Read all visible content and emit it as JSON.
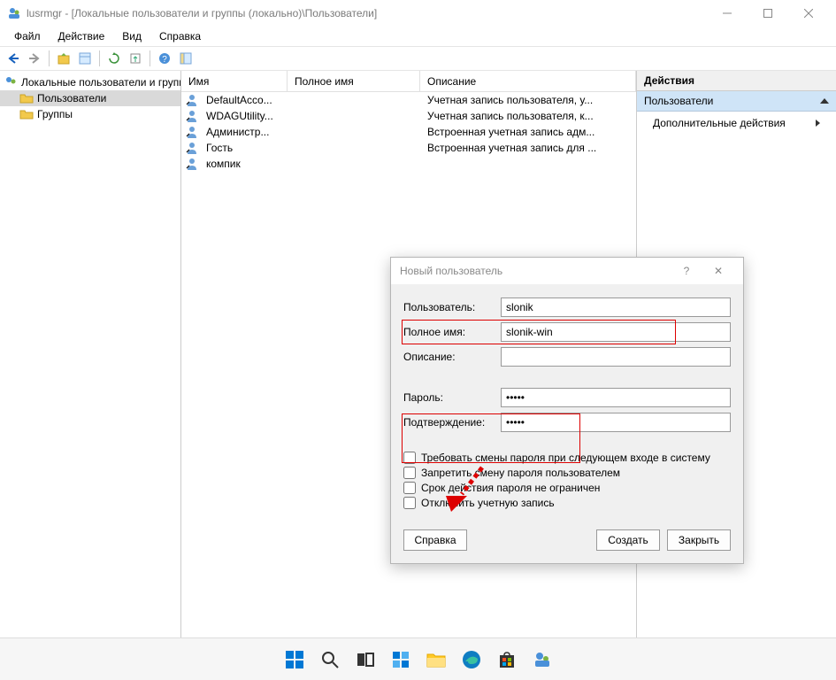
{
  "titlebar": {
    "text": "lusrmgr - [Локальные пользователи и группы (локально)\\Пользователи]"
  },
  "menubar": [
    "Файл",
    "Действие",
    "Вид",
    "Справка"
  ],
  "tree": {
    "root": "Локальные пользователи и группы",
    "users": "Пользователи",
    "groups": "Группы"
  },
  "list": {
    "headers": {
      "name": "Имя",
      "full": "Полное имя",
      "desc": "Описание"
    },
    "rows": [
      {
        "name": "DefaultAcco...",
        "full": "",
        "desc": "Учетная запись пользователя, у..."
      },
      {
        "name": "WDAGUtility...",
        "full": "",
        "desc": "Учетная запись пользователя, к..."
      },
      {
        "name": "Администр...",
        "full": "",
        "desc": "Встроенная учетная запись адм..."
      },
      {
        "name": "Гость",
        "full": "",
        "desc": "Встроенная учетная запись для ..."
      },
      {
        "name": "компик",
        "full": "",
        "desc": ""
      }
    ]
  },
  "actions": {
    "title": "Действия",
    "section": "Пользователи",
    "item": "Дополнительные действия"
  },
  "dialog": {
    "title": "Новый пользователь",
    "labels": {
      "user": "Пользователь:",
      "full": "Полное имя:",
      "desc": "Описание:",
      "pass": "Пароль:",
      "confirm": "Подтверждение:"
    },
    "values": {
      "user": "slonik",
      "full": "slonik-win",
      "desc": "",
      "pass": "•••••",
      "confirm": "•••••"
    },
    "checks": [
      "Требовать смены пароля при следующем входе в систему",
      "Запретить смену пароля пользователем",
      "Срок действия пароля не ограничен",
      "Отключить учетную запись"
    ],
    "buttons": {
      "help": "Справка",
      "create": "Создать",
      "close": "Закрыть"
    }
  }
}
